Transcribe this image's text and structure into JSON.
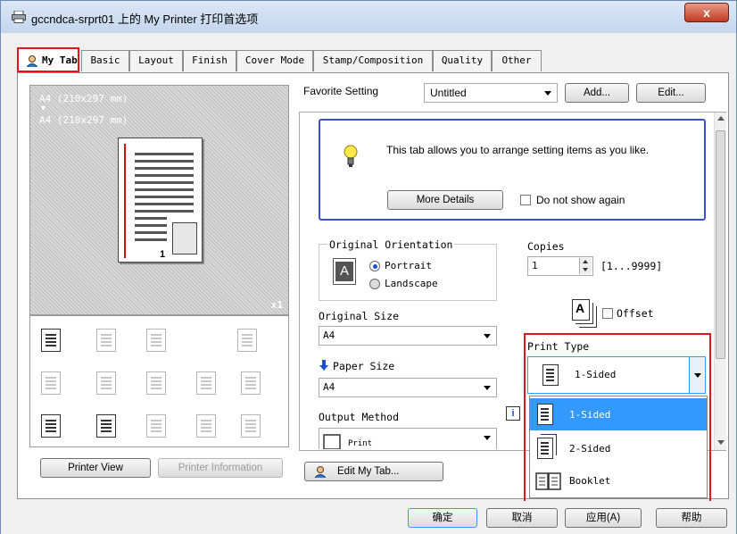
{
  "window": {
    "title": "gccndca-srprt01 上的 My Printer 打印首选项",
    "close_glyph": "x",
    "icons": {
      "title": "printer-icon",
      "close": "close-icon"
    },
    "colors": {
      "accent": "#3a52cc",
      "highlight": "#3399ff",
      "callout": "#e0141f"
    }
  },
  "tabs": [
    {
      "label": "My Tab"
    },
    {
      "label": "Basic"
    },
    {
      "label": "Layout"
    },
    {
      "label": "Finish"
    },
    {
      "label": "Cover Mode"
    },
    {
      "label": "Stamp/Composition"
    },
    {
      "label": "Quality"
    },
    {
      "label": "Other"
    }
  ],
  "preview": {
    "paper_line1": "A4  (210x297 mm)",
    "arrow": "▼",
    "paper_line2": "A4  (210x297 mm)",
    "page_number": "1",
    "copies_badge": "x1"
  },
  "left_buttons": {
    "printer_view": "Printer View",
    "printer_information": "Printer Information"
  },
  "favorite": {
    "label": "Favorite Setting",
    "value": "Untitled",
    "add": "Add...",
    "edit": "Edit..."
  },
  "info": {
    "text": "This tab allows you to arrange setting items as you like.",
    "more_details": "More Details",
    "do_not_show": "Do not show again"
  },
  "orientation": {
    "label": "Original Orientation",
    "glyph": "A",
    "portrait": "Portrait",
    "landscape": "Landscape",
    "selected": "Portrait"
  },
  "copies": {
    "label": "Copies",
    "value": "1",
    "range": "[1...9999]",
    "glyph": "A",
    "offset": "Offset"
  },
  "original_size": {
    "label": "Original Size",
    "value": "A4"
  },
  "paper_size": {
    "label": "Paper Size",
    "value": "A4"
  },
  "output_method": {
    "label": "Output Method",
    "value": "Print"
  },
  "print_type": {
    "label": "Print Type",
    "value": "1-Sided",
    "options": [
      "1-Sided",
      "2-Sided",
      "Booklet"
    ],
    "highlighted": "1-Sided"
  },
  "edit_my_tab": "Edit My Tab...",
  "info_icon_glyph": "i",
  "bottom": {
    "ok": "确定",
    "cancel": "取消",
    "apply": "应用(A)",
    "help": "帮助"
  }
}
